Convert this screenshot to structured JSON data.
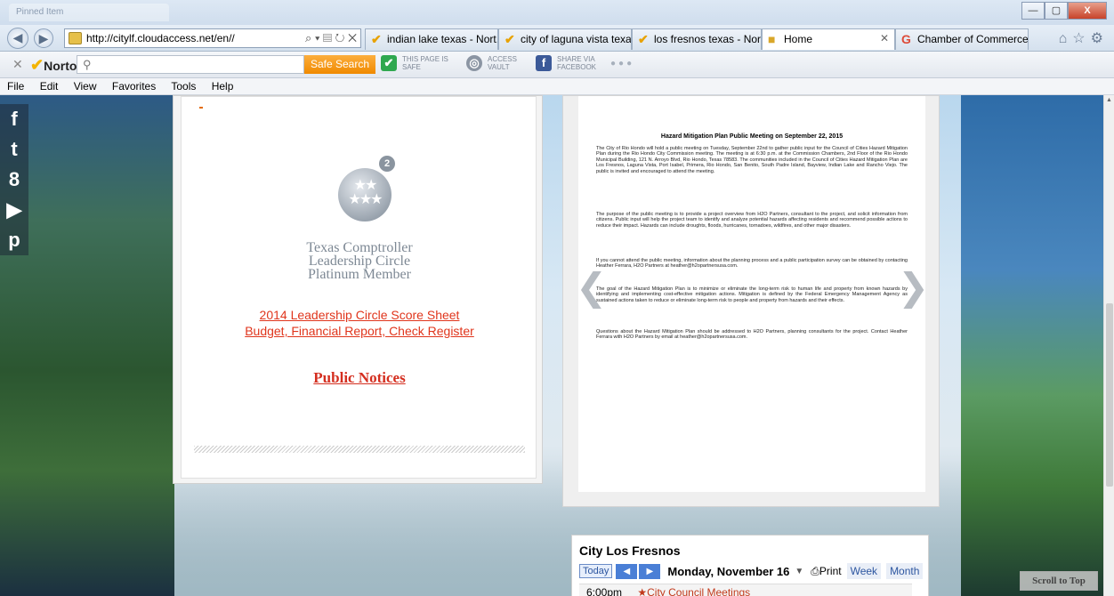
{
  "browser": {
    "ghost_tab": "Pinned Item",
    "url": "http://citylf.cloudaccess.net/en//",
    "tabs": [
      {
        "label": "indian lake texas - Nort...",
        "icon": "norton-check-icon"
      },
      {
        "label": "city of laguna vista texa...",
        "icon": "norton-check-icon"
      },
      {
        "label": "los fresnos texas - Nort...",
        "icon": "norton-check-icon"
      },
      {
        "label": "Home",
        "icon": "site-favicon"
      },
      {
        "label": "Chamber of Commerce...",
        "icon": "google-icon"
      }
    ],
    "window_buttons": {
      "min": "—",
      "max": "▢",
      "close": "X"
    }
  },
  "norton": {
    "logo": "Norton",
    "search_placeholder": "",
    "search_button": "Safe Search",
    "safe_line1": "THIS PAGE IS",
    "safe_line2": "SAFE",
    "vault_line1": "ACCESS",
    "vault_line2": "VAULT",
    "share_line1": "SHARE VIA",
    "share_line2": "FACEBOOK"
  },
  "menu": [
    "File",
    "Edit",
    "View",
    "Favorites",
    "Tools",
    "Help"
  ],
  "social": [
    "f",
    "t",
    "8",
    "▶",
    "p"
  ],
  "left_panel": {
    "seal_number": "2",
    "seal_text": "Texas Comptroller",
    "comptroller_lines": [
      "Texas Comptroller",
      "Leadership Circle",
      "Platinum Member"
    ],
    "link1": "2014 Leadership Circle Score Sheet",
    "link2": "Budget, Financial Report, Check Register",
    "public_notices": "Public Notices"
  },
  "doc": {
    "title": "Hazard Mitigation Plan Public Meeting on September 22, 2015",
    "paragraphs": [
      "The City of Rio Hondo will hold a public meeting on Tuesday, September 22nd to gather public input for the Council of Cities Hazard Mitigation Plan during the Rio Hondo City Commission meeting. The meeting is at 6:30 p.m. at the Commission Chambers, 2nd Floor of the Rio Hondo Municipal Building, 121 N. Arroyo Blvd, Rio Hondo, Texas 78583. The communities included in the Council of Cities Hazard Mitigation Plan are Los Fresnos, Laguna Vista, Port Isabel, Primera, Rio Hondo, San Benito, South Padre Island, Bayview, Indian Lake and Rancho Viejo. The public is invited and encouraged to attend the meeting.",
      "The purpose of the public meeting is to provide a project overview from H2O Partners, consultant to the project, and solicit information from citizens. Public input will help the project team to identify and analyze potential hazards affecting residents and recommend possible actions to reduce their impact. Hazards can include droughts, floods, hurricanes, tornadoes, wildfires, and other major disasters.",
      "If you cannot attend the public meeting, information about the planning process and a public participation survey can be obtained by contacting Heather Ferrara, H2O Partners at heather@h2opartnersusa.com.",
      "The goal of the Hazard Mitigation Plan is to minimize or eliminate the long-term risk to human life and property from known hazards by identifying and implementing cost-effective mitigation actions. Mitigation is defined by the Federal Emergency Management Agency as sustained actions taken to reduce or eliminate long-term risk to people and property from hazards and their effects.",
      "Questions about the Hazard Mitigation Plan should be addressed to H2O Partners, planning consultants for the project. Contact Heather Ferrara with H2O Partners by email at heather@h2opartnersusa.com."
    ]
  },
  "calendar": {
    "title": "City Los Fresnos",
    "today": "Today",
    "date": "Monday, November 16",
    "print": "Print",
    "week": "Week",
    "month": "Month",
    "event_time": "6:00pm",
    "event_name": "City Council Meetings"
  },
  "scroll_top": "Scroll to Top"
}
